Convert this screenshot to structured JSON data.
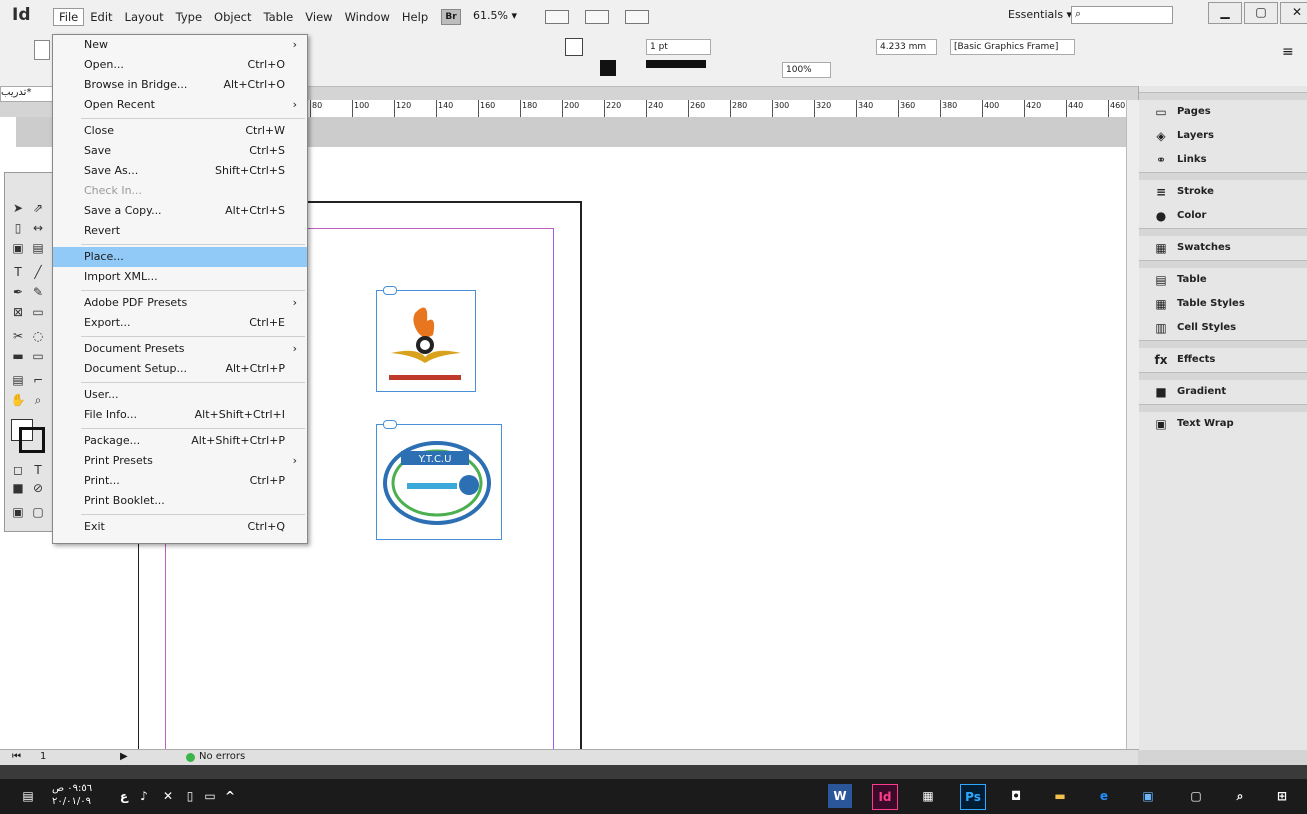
{
  "app": {
    "logo": "Id",
    "zoom": "61.5% ▾",
    "bridge": "Br",
    "workspace": "Essentials ▾"
  },
  "menubar": [
    "File",
    "Edit",
    "Layout",
    "Type",
    "Object",
    "Table",
    "View",
    "Window",
    "Help"
  ],
  "control": {
    "stroke_weight": "1 pt",
    "percent": "100%",
    "measure": "4.233 mm",
    "frame_style": "[Basic Graphics Frame]"
  },
  "document": {
    "tab": "تدريب*"
  },
  "ruler": [
    "80",
    "100",
    "120",
    "140",
    "160",
    "180",
    "200",
    "220",
    "240",
    "260",
    "280",
    "300",
    "320",
    "340",
    "360",
    "380",
    "400",
    "420",
    "440",
    "460"
  ],
  "file_menu": {
    "items": [
      {
        "label": "New",
        "shortcut": "",
        "submenu": true
      },
      {
        "label": "Open...",
        "shortcut": "Ctrl+O"
      },
      {
        "label": "Browse in Bridge...",
        "shortcut": "Alt+Ctrl+O"
      },
      {
        "label": "Open Recent",
        "shortcut": "",
        "submenu": true
      },
      {
        "label": "Close",
        "shortcut": "Ctrl+W"
      },
      {
        "label": "Save",
        "shortcut": "Ctrl+S"
      },
      {
        "label": "Save As...",
        "shortcut": "Shift+Ctrl+S"
      },
      {
        "label": "Check In...",
        "shortcut": "",
        "disabled": true
      },
      {
        "label": "Save a Copy...",
        "shortcut": "Alt+Ctrl+S"
      },
      {
        "label": "Revert",
        "shortcut": ""
      },
      {
        "label": "Place...",
        "shortcut": "",
        "highlighted": true
      },
      {
        "label": "Import XML...",
        "shortcut": ""
      },
      {
        "label": "Adobe PDF Presets",
        "shortcut": "",
        "submenu": true
      },
      {
        "label": "Export...",
        "shortcut": "Ctrl+E"
      },
      {
        "label": "Document Presets",
        "shortcut": "",
        "submenu": true
      },
      {
        "label": "Document Setup...",
        "shortcut": "Alt+Ctrl+P"
      },
      {
        "label": "User...",
        "shortcut": ""
      },
      {
        "label": "File Info...",
        "shortcut": "Alt+Shift+Ctrl+I"
      },
      {
        "label": "Package...",
        "shortcut": "Alt+Shift+Ctrl+P"
      },
      {
        "label": "Print Presets",
        "shortcut": "",
        "submenu": true
      },
      {
        "label": "Print...",
        "shortcut": "Ctrl+P"
      },
      {
        "label": "Print Booklet...",
        "shortcut": ""
      },
      {
        "label": "Exit",
        "shortcut": "Ctrl+Q"
      }
    ]
  },
  "panels": [
    "Pages",
    "Layers",
    "Links",
    "Stroke",
    "Color",
    "Swatches",
    "Table",
    "Table Styles",
    "Cell Styles",
    "Effects",
    "Gradient",
    "Text Wrap"
  ],
  "status": {
    "page": "1",
    "errors": "No errors"
  },
  "frame2_text": "Y.T.C.U",
  "taskbar": {
    "time": "٠٩:٥٦ ص",
    "date": "٢٠/٠١/٠٩",
    "lang": "ع",
    "apps": [
      "W",
      "Id",
      "",
      "Ps",
      "",
      "",
      "e",
      "",
      "",
      ""
    ]
  },
  "colors": {
    "highlight": "#91c9f7",
    "frame": "#4a90d9",
    "margin": "#c060c0"
  }
}
